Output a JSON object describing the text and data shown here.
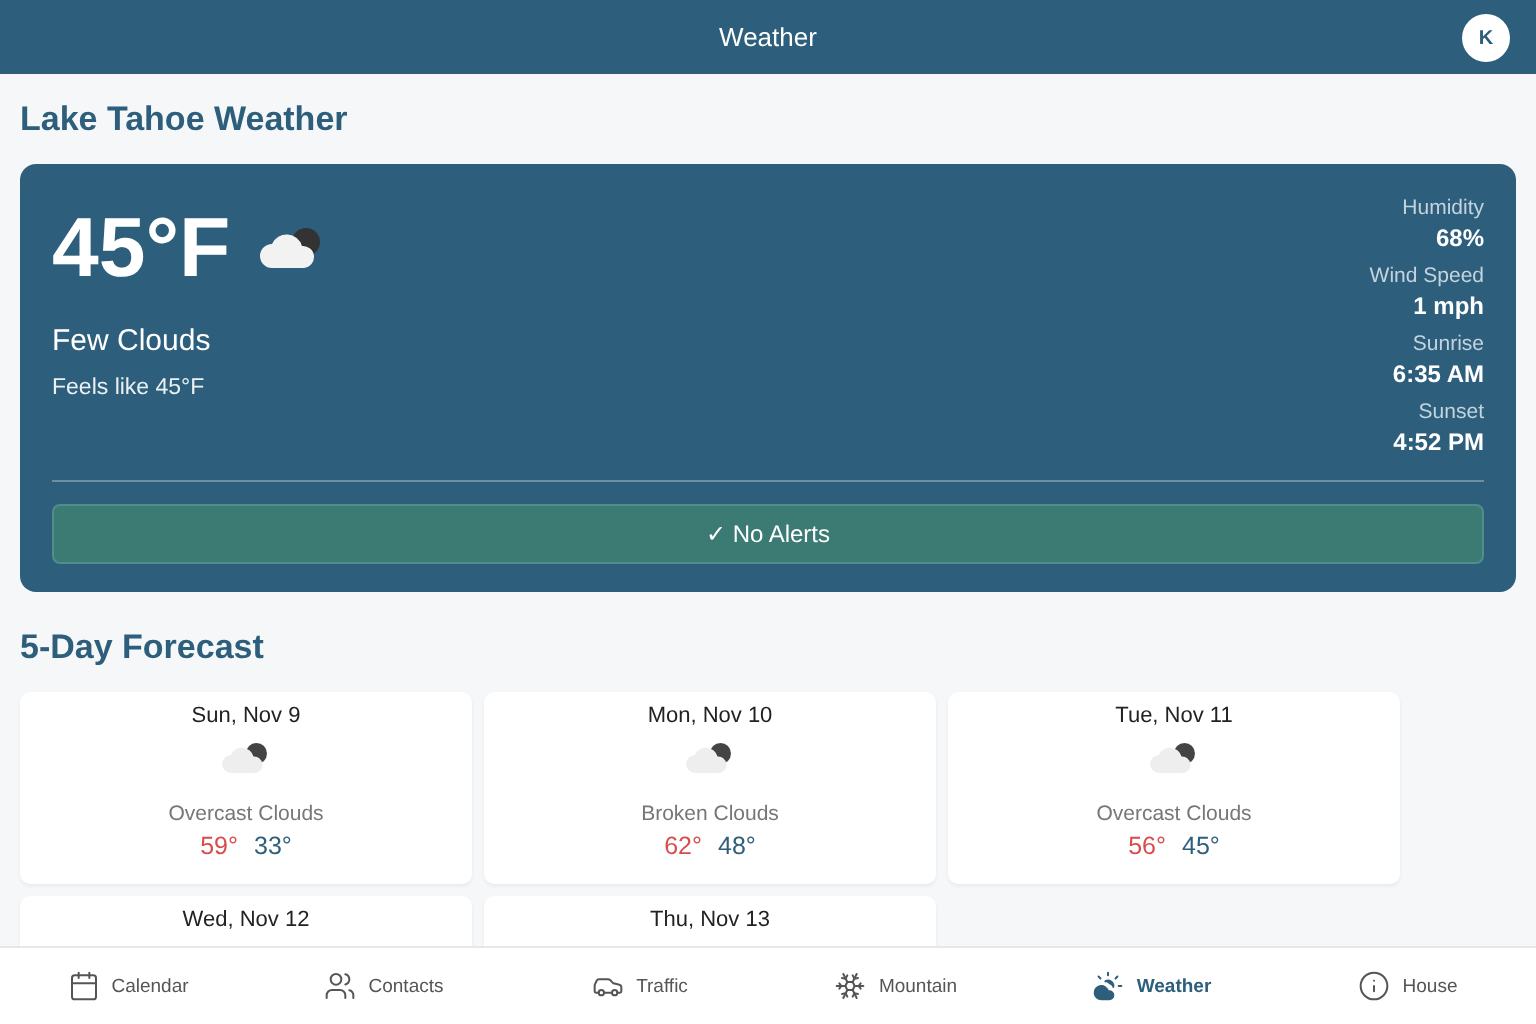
{
  "header": {
    "title": "Weather",
    "avatar": "K"
  },
  "page_title": "Lake Tahoe Weather",
  "current": {
    "temperature": "45°F",
    "condition": "Few Clouds",
    "feels_like": "Feels like 45°F",
    "stats": [
      {
        "label": "Humidity",
        "value": "68%"
      },
      {
        "label": "Wind Speed",
        "value": "1 mph"
      },
      {
        "label": "Sunrise",
        "value": "6:35 AM"
      },
      {
        "label": "Sunset",
        "value": "4:52 PM"
      }
    ],
    "alerts": "✓ No Alerts"
  },
  "forecast_title": "5-Day Forecast",
  "forecast": [
    {
      "date": "Sun, Nov 9",
      "condition": "Overcast Clouds",
      "high": "59°",
      "low": "33°"
    },
    {
      "date": "Mon, Nov 10",
      "condition": "Broken Clouds",
      "high": "62°",
      "low": "48°"
    },
    {
      "date": "Tue, Nov 11",
      "condition": "Overcast Clouds",
      "high": "56°",
      "low": "45°"
    },
    {
      "date": "Wed, Nov 12"
    },
    {
      "date": "Thu, Nov 13"
    }
  ],
  "tabs": [
    {
      "label": "Calendar",
      "kind": "calendar",
      "selected": false
    },
    {
      "label": "Contacts",
      "kind": "contacts",
      "selected": false
    },
    {
      "label": "Traffic",
      "kind": "traffic",
      "selected": false
    },
    {
      "label": "Mountain",
      "kind": "mountain",
      "selected": false
    },
    {
      "label": "Weather",
      "kind": "weather",
      "selected": true
    },
    {
      "label": "House",
      "kind": "house",
      "selected": false
    }
  ]
}
